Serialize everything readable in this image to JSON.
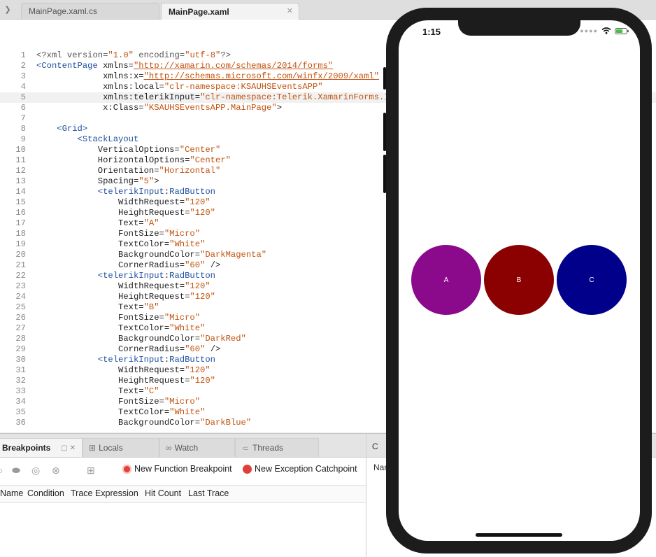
{
  "tabs": [
    {
      "label": "MainPage.xaml.cs"
    },
    {
      "label": "MainPage.xaml"
    }
  ],
  "editor": {
    "lines": [
      {
        "num": "1",
        "parts": [
          [
            "xml",
            "<?xml version="
          ],
          [
            "str",
            "\"1.0\""
          ],
          [
            "xml",
            " encoding="
          ],
          [
            "str",
            "\"utf-8\""
          ],
          [
            "xml",
            "?>"
          ]
        ]
      },
      {
        "num": "2",
        "parts": [
          [
            "tag",
            "<ContentPage"
          ],
          [
            "txt",
            " xmlns="
          ],
          [
            "url",
            "\"http://xamarin.com/schemas/2014/forms\""
          ]
        ]
      },
      {
        "num": "3",
        "parts": [
          [
            "txt",
            "             xmlns:x="
          ],
          [
            "url",
            "\"http://schemas.microsoft.com/winfx/2009/xaml\""
          ]
        ]
      },
      {
        "num": "4",
        "parts": [
          [
            "txt",
            "             xmlns:local="
          ],
          [
            "str",
            "\"clr-namespace:KSAUHSEventsAPP\""
          ]
        ]
      },
      {
        "num": "5",
        "parts": [
          [
            "txt",
            "             xmlns:telerikInput="
          ],
          [
            "str",
            "\"clr-namespace:Telerik.XamarinForms.Input;assembly=Telerik.XamarinForms.Input\""
          ]
        ]
      },
      {
        "num": "6",
        "parts": [
          [
            "txt",
            "             x:Class="
          ],
          [
            "str",
            "\"KSAUHSEventsAPP.MainPage\""
          ],
          [
            "txt",
            ">"
          ]
        ]
      },
      {
        "num": "7",
        "parts": []
      },
      {
        "num": "8",
        "parts": [
          [
            "txt",
            "    "
          ],
          [
            "tag",
            "<Grid>"
          ]
        ]
      },
      {
        "num": "9",
        "parts": [
          [
            "txt",
            "        "
          ],
          [
            "tag",
            "<StackLayout"
          ]
        ]
      },
      {
        "num": "10",
        "parts": [
          [
            "txt",
            "            VerticalOptions="
          ],
          [
            "str",
            "\"Center\""
          ]
        ]
      },
      {
        "num": "11",
        "parts": [
          [
            "txt",
            "            HorizontalOptions="
          ],
          [
            "str",
            "\"Center\""
          ]
        ]
      },
      {
        "num": "12",
        "parts": [
          [
            "txt",
            "            Orientation="
          ],
          [
            "str",
            "\"Horizontal\""
          ]
        ]
      },
      {
        "num": "13",
        "parts": [
          [
            "txt",
            "            Spacing="
          ],
          [
            "str",
            "\"5\""
          ],
          [
            "txt",
            ">"
          ]
        ]
      },
      {
        "num": "14",
        "parts": [
          [
            "txt",
            "            "
          ],
          [
            "tag",
            "<telerikInput"
          ],
          [
            "txt",
            ":"
          ],
          [
            "tag",
            "RadButton"
          ]
        ]
      },
      {
        "num": "15",
        "parts": [
          [
            "txt",
            "                WidthRequest="
          ],
          [
            "str",
            "\"120\""
          ]
        ]
      },
      {
        "num": "16",
        "parts": [
          [
            "txt",
            "                HeightRequest="
          ],
          [
            "str",
            "\"120\""
          ]
        ]
      },
      {
        "num": "17",
        "parts": [
          [
            "txt",
            "                Text="
          ],
          [
            "str",
            "\"A\""
          ]
        ]
      },
      {
        "num": "18",
        "parts": [
          [
            "txt",
            "                FontSize="
          ],
          [
            "str",
            "\"Micro\""
          ]
        ]
      },
      {
        "num": "19",
        "parts": [
          [
            "txt",
            "                TextColor="
          ],
          [
            "str",
            "\"White\""
          ]
        ]
      },
      {
        "num": "20",
        "parts": [
          [
            "txt",
            "                BackgroundColor="
          ],
          [
            "str",
            "\"DarkMagenta\""
          ]
        ]
      },
      {
        "num": "21",
        "parts": [
          [
            "txt",
            "                CornerRadius="
          ],
          [
            "str",
            "\"60\""
          ],
          [
            "txt",
            " />"
          ]
        ]
      },
      {
        "num": "22",
        "parts": [
          [
            "txt",
            "            "
          ],
          [
            "tag",
            "<telerikInput"
          ],
          [
            "txt",
            ":"
          ],
          [
            "tag",
            "RadButton"
          ]
        ]
      },
      {
        "num": "23",
        "parts": [
          [
            "txt",
            "                WidthRequest="
          ],
          [
            "str",
            "\"120\""
          ]
        ]
      },
      {
        "num": "24",
        "parts": [
          [
            "txt",
            "                HeightRequest="
          ],
          [
            "str",
            "\"120\""
          ]
        ]
      },
      {
        "num": "25",
        "parts": [
          [
            "txt",
            "                Text="
          ],
          [
            "str",
            "\"B\""
          ]
        ]
      },
      {
        "num": "26",
        "parts": [
          [
            "txt",
            "                FontSize="
          ],
          [
            "str",
            "\"Micro\""
          ]
        ]
      },
      {
        "num": "27",
        "parts": [
          [
            "txt",
            "                TextColor="
          ],
          [
            "str",
            "\"White\""
          ]
        ]
      },
      {
        "num": "28",
        "parts": [
          [
            "txt",
            "                BackgroundColor="
          ],
          [
            "str",
            "\"DarkRed\""
          ]
        ]
      },
      {
        "num": "29",
        "parts": [
          [
            "txt",
            "                CornerRadius="
          ],
          [
            "str",
            "\"60\""
          ],
          [
            "txt",
            " />"
          ]
        ]
      },
      {
        "num": "30",
        "parts": [
          [
            "txt",
            "            "
          ],
          [
            "tag",
            "<telerikInput"
          ],
          [
            "txt",
            ":"
          ],
          [
            "tag",
            "RadButton"
          ]
        ]
      },
      {
        "num": "31",
        "parts": [
          [
            "txt",
            "                WidthRequest="
          ],
          [
            "str",
            "\"120\""
          ]
        ]
      },
      {
        "num": "32",
        "parts": [
          [
            "txt",
            "                HeightRequest="
          ],
          [
            "str",
            "\"120\""
          ]
        ]
      },
      {
        "num": "33",
        "parts": [
          [
            "txt",
            "                Text="
          ],
          [
            "str",
            "\"C\""
          ]
        ]
      },
      {
        "num": "34",
        "parts": [
          [
            "txt",
            "                FontSize="
          ],
          [
            "str",
            "\"Micro\""
          ]
        ]
      },
      {
        "num": "35",
        "parts": [
          [
            "txt",
            "                TextColor="
          ],
          [
            "str",
            "\"White\""
          ]
        ]
      },
      {
        "num": "36",
        "parts": [
          [
            "txt",
            "                BackgroundColor="
          ],
          [
            "str",
            "\"DarkBlue\""
          ]
        ]
      }
    ],
    "current_line": "5"
  },
  "pads": {
    "tabs": [
      {
        "label": "Breakpoints",
        "icon": ""
      },
      {
        "label": "Locals",
        "icon": "locals-icon"
      },
      {
        "label": "Watch",
        "icon": "watch-icon"
      },
      {
        "label": "Threads",
        "icon": "threads-icon"
      }
    ],
    "toolbar": {
      "new_function_breakpoint": "New Function Breakpoint",
      "new_exception_catchpoint": "New Exception Catchpoint"
    },
    "columns": [
      "Name",
      "Condition",
      "Trace Expression",
      "Hit Count",
      "Last Trace"
    ]
  },
  "right_pad": {
    "label": "C",
    "column": "Nan"
  },
  "phone": {
    "time": "1:15",
    "buttons": [
      {
        "text": "A",
        "color": "#8B0A8B"
      },
      {
        "text": "B",
        "color": "#8B0000"
      },
      {
        "text": "C",
        "color": "#00008B"
      }
    ]
  },
  "colors": {
    "tag": "#1f4f9f",
    "string": "#c2530f",
    "function_bp": "#e0403a",
    "exception_bp": "#e0403a"
  }
}
